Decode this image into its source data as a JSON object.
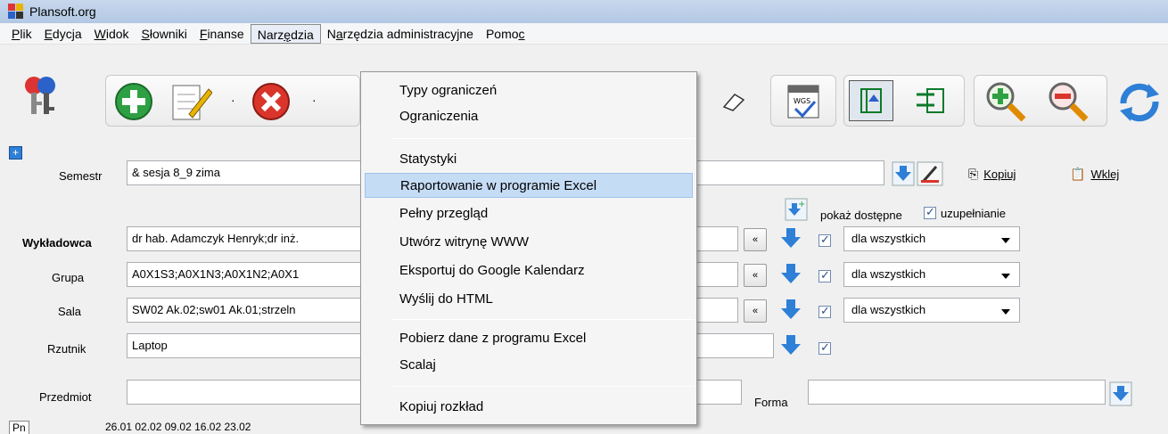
{
  "window": {
    "title": "Plansoft.org"
  },
  "menubar": {
    "items": [
      {
        "label": "Plik",
        "mn": "P"
      },
      {
        "label": "Edycja",
        "mn": "E"
      },
      {
        "label": "Widok",
        "mn": "W"
      },
      {
        "label": "Słowniki",
        "mn": "S"
      },
      {
        "label": "Finanse",
        "mn": "F"
      },
      {
        "label": "Narzędzia",
        "active": true
      },
      {
        "label": "Narzędzia administracyjne"
      },
      {
        "label": "Pomoc"
      }
    ]
  },
  "dropdown": {
    "items": [
      "Typy ograniczeń",
      "Ograniczenia",
      "Statystyki",
      "Raportowanie w programie Excel",
      "Pełny przegląd",
      "Utwórz witrynę WWW",
      "Eksportuj do Google Kalendarz",
      "Wyślij do HTML",
      "Pobierz dane z programu Excel",
      "Scalaj",
      "Kopiuj rozkład"
    ],
    "highlighted": "Raportowanie w programie Excel"
  },
  "form": {
    "semestr_label": "Semestr",
    "semestr_value": "& sesja 8_9 zima",
    "wykladowca_label": "Wykładowca",
    "wykladowca_value": "dr hab. Adamczyk Henryk;dr inż.",
    "grupa_label": "Grupa",
    "grupa_value": "A0X1S3;A0X1N3;A0X1N2;A0X1",
    "sala_label": "Sala",
    "sala_value": "SW02 Ak.02;sw01 Ak.01;strzeln",
    "rzutnik_label": "Rzutnik",
    "rzutnik_value": "Laptop",
    "przedmiot_label": "Przedmiot",
    "przedmiot_value": "",
    "forma_label": "Forma",
    "forma_value": "",
    "pokaz_dostepne": "pokaż dostępne",
    "uzupelnianie": "uzupełnianie",
    "kopiuj": "Kopiuj",
    "wklej": "Wklej",
    "combo_value": "dla wszystkich",
    "nav_prev": "«"
  },
  "bottom": {
    "day": "Pn",
    "dates": "26.01 02.02 09.02 16.02 23.02"
  },
  "colors": {
    "accent_blue": "#2e7fd6",
    "green": "#2ea043",
    "red": "#d9352b",
    "highlight": "#c5dcf5"
  }
}
